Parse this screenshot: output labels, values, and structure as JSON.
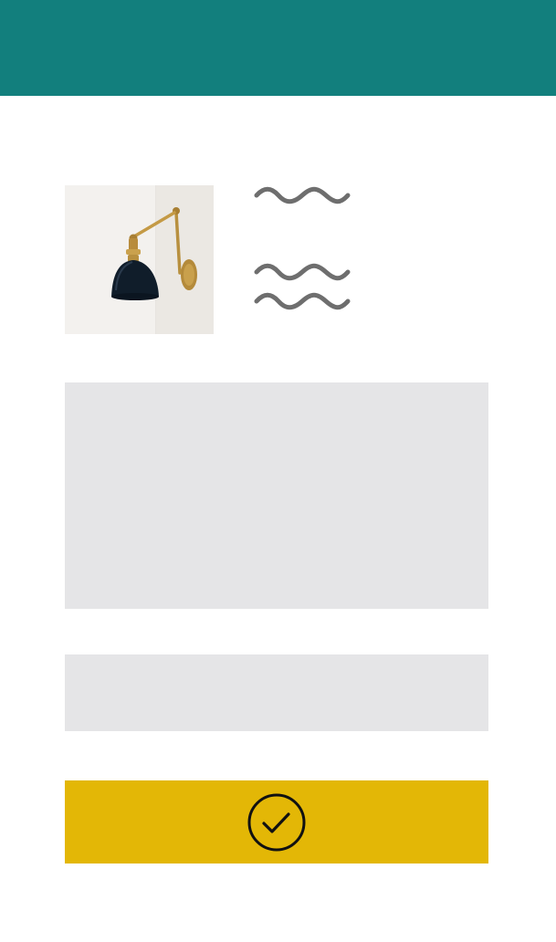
{
  "header": {
    "background_color": "#127f7d"
  },
  "product": {
    "image_icon": "wall-lamp-image",
    "title_placeholder_icon": "squiggle-text-placeholder",
    "description_placeholder_icon": "squiggle-text-placeholder"
  },
  "form": {
    "textarea_value": "",
    "input_value": "",
    "field_color": "#e5e5e7"
  },
  "confirm_button": {
    "icon": "check-circle-icon",
    "color": "#e3b706"
  }
}
